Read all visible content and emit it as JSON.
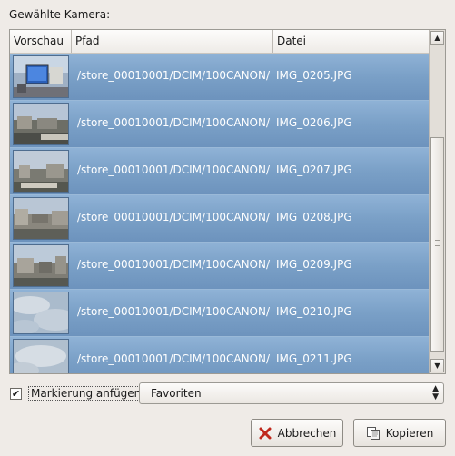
{
  "dialog": {
    "camera_label": "Gewählte Kamera:"
  },
  "table": {
    "columns": {
      "preview": "Vorschau",
      "path": "Pfad",
      "file": "Datei"
    },
    "rows": [
      {
        "path": "/store_00010001/DCIM/100CANON/",
        "file": "IMG_0205.JPG"
      },
      {
        "path": "/store_00010001/DCIM/100CANON/",
        "file": "IMG_0206.JPG"
      },
      {
        "path": "/store_00010001/DCIM/100CANON/",
        "file": "IMG_0207.JPG"
      },
      {
        "path": "/store_00010001/DCIM/100CANON/",
        "file": "IMG_0208.JPG"
      },
      {
        "path": "/store_00010001/DCIM/100CANON/",
        "file": "IMG_0209.JPG"
      },
      {
        "path": "/store_00010001/DCIM/100CANON/",
        "file": "IMG_0210.JPG"
      },
      {
        "path": "/store_00010001/DCIM/100CANON/",
        "file": "IMG_0211.JPG"
      }
    ]
  },
  "tagging": {
    "checkbox_label": "Markierung anfügen:",
    "checked": true,
    "selected_tag": "Favoriten"
  },
  "buttons": {
    "cancel_label": "Abbrechen",
    "copy_label": "Kopieren"
  },
  "colors": {
    "selection": "#7aa0c7",
    "background": "#efebe7"
  }
}
